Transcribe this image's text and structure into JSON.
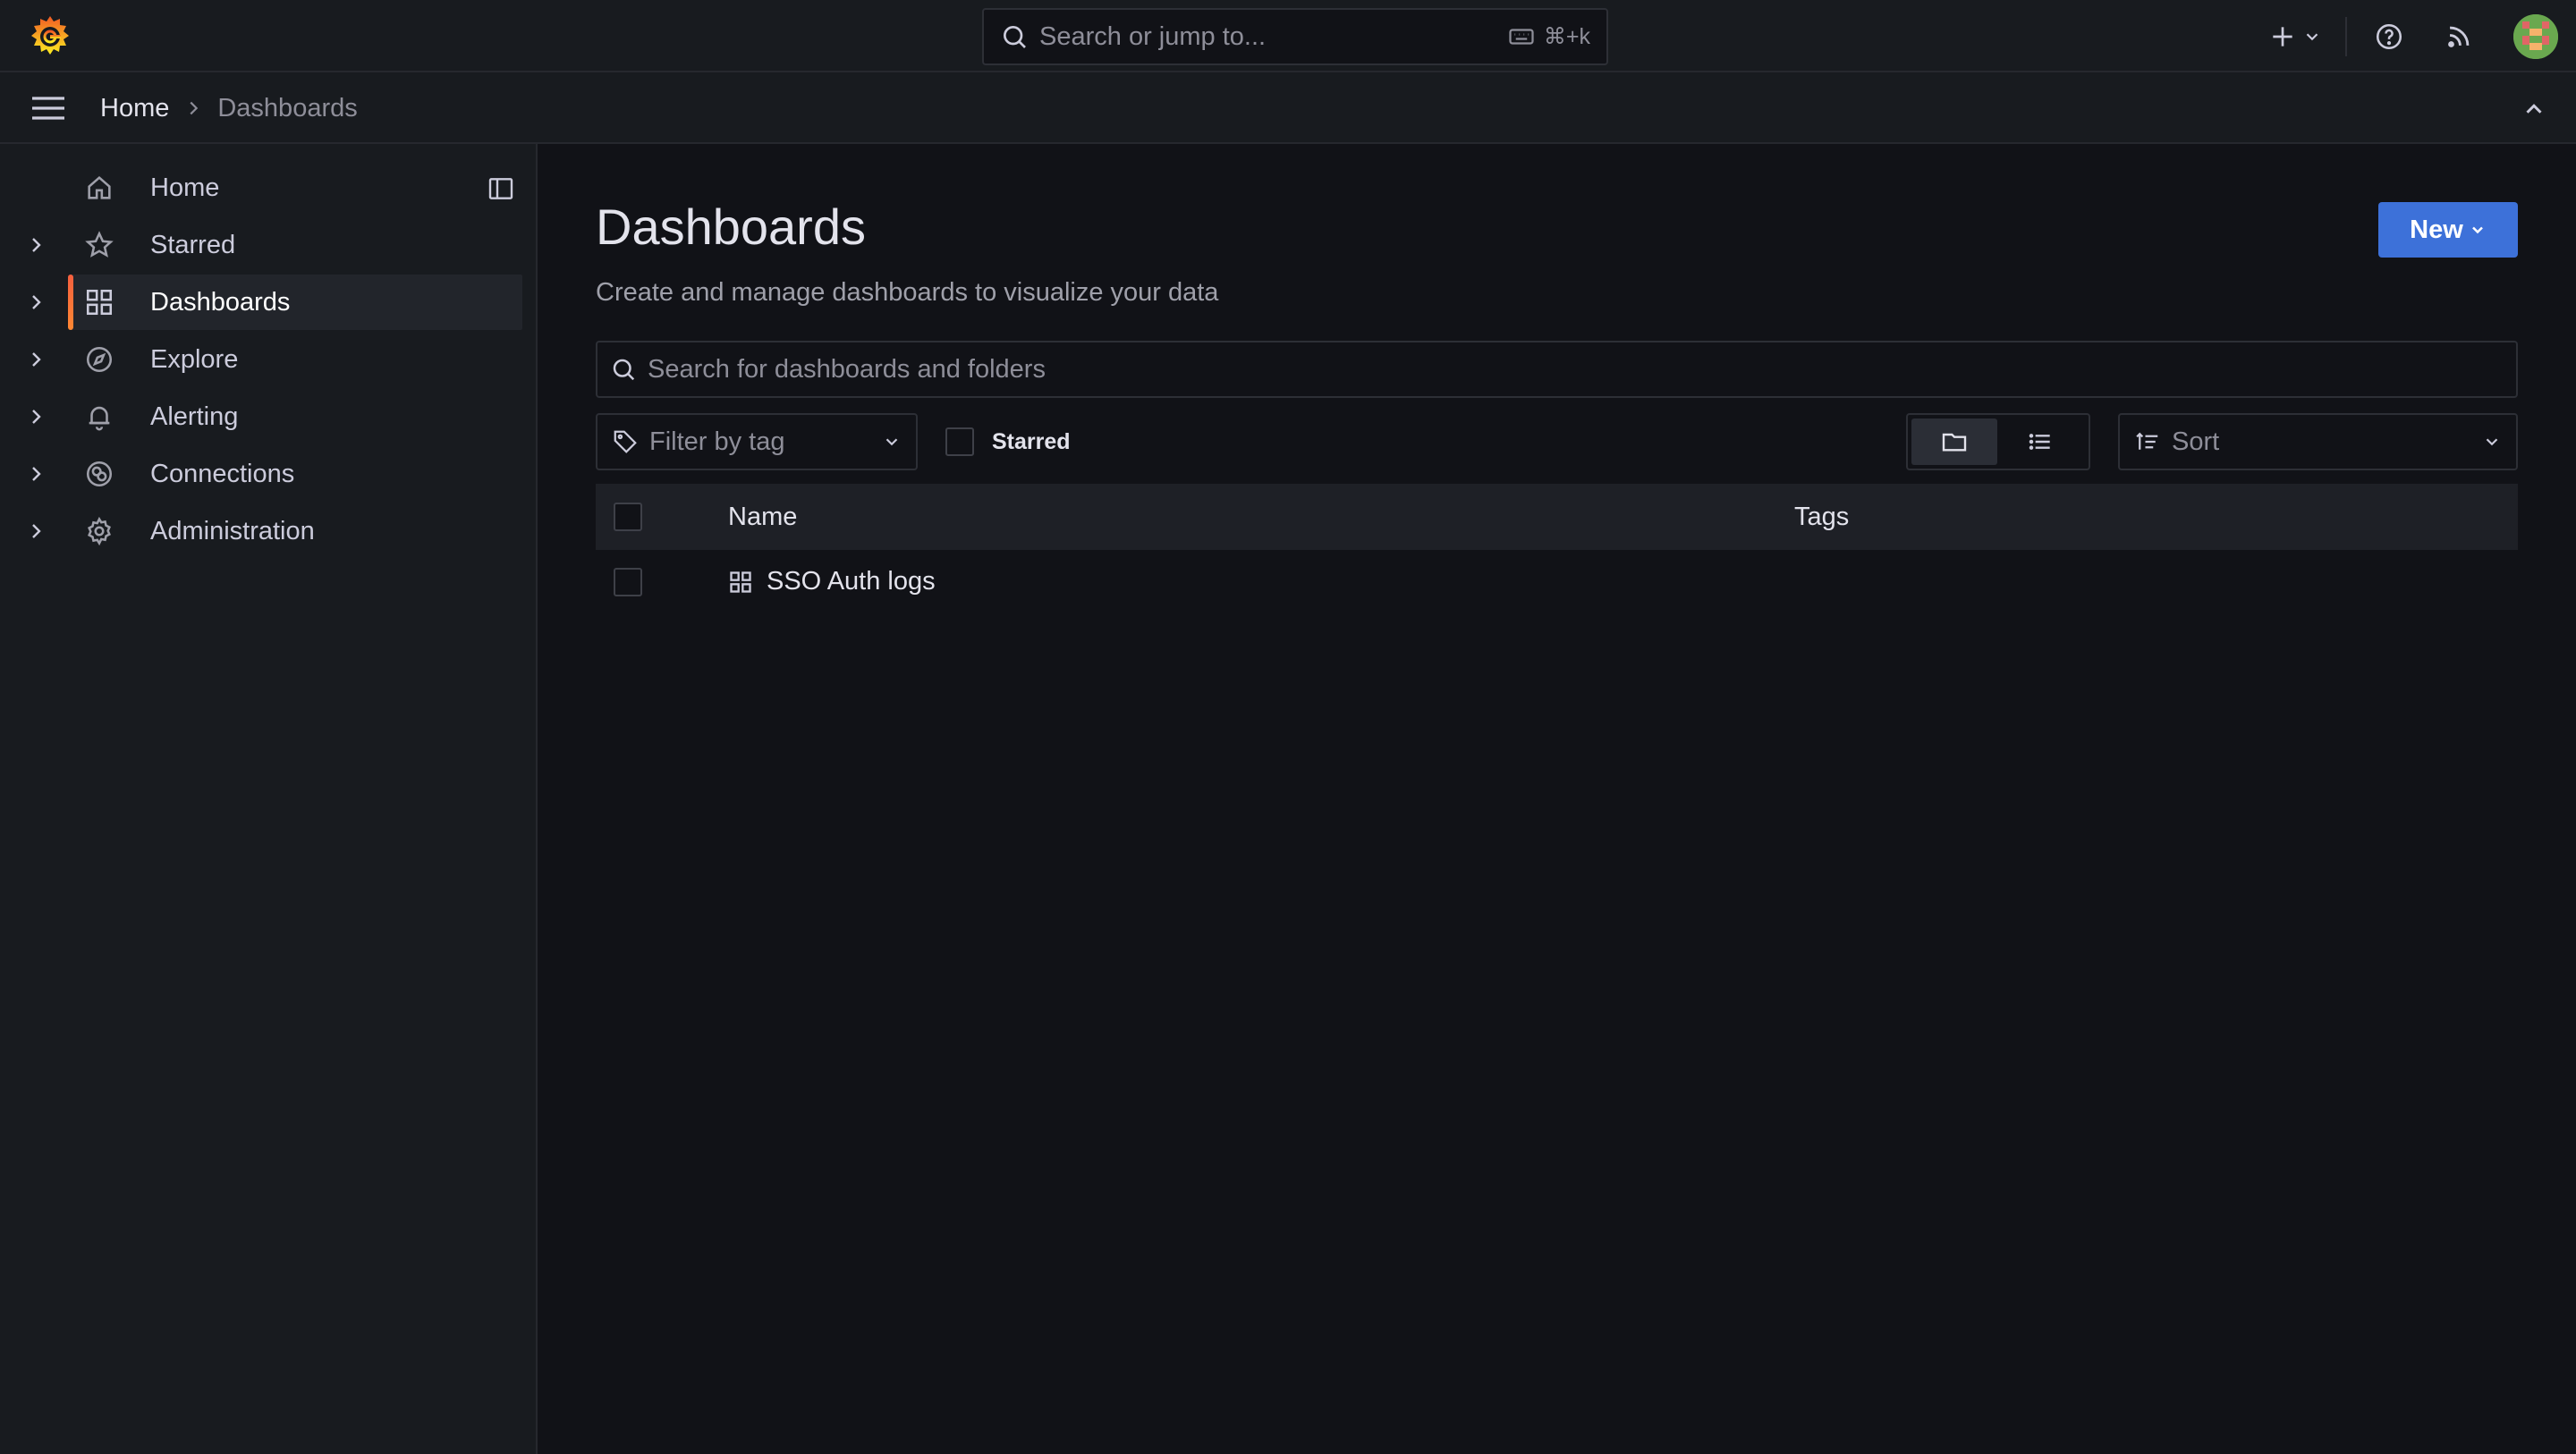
{
  "topbar": {
    "search_placeholder": "Search or jump to...",
    "search_shortcut": "⌘+k"
  },
  "breadcrumb": {
    "items": [
      "Home",
      "Dashboards"
    ]
  },
  "sidebar": {
    "items": [
      {
        "label": "Home",
        "icon": "home-icon",
        "expandable": false
      },
      {
        "label": "Starred",
        "icon": "star-icon",
        "expandable": true
      },
      {
        "label": "Dashboards",
        "icon": "apps-grid-icon",
        "expandable": true,
        "active": true
      },
      {
        "label": "Explore",
        "icon": "compass-icon",
        "expandable": true
      },
      {
        "label": "Alerting",
        "icon": "bell-icon",
        "expandable": true
      },
      {
        "label": "Connections",
        "icon": "connections-icon",
        "expandable": true
      },
      {
        "label": "Administration",
        "icon": "gear-icon",
        "expandable": true
      }
    ]
  },
  "main": {
    "title": "Dashboards",
    "subtitle": "Create and manage dashboards to visualize your data",
    "new_button": "New",
    "search_placeholder": "Search for dashboards and folders",
    "tag_filter_placeholder": "Filter by tag",
    "starred_label": "Starred",
    "sort_placeholder": "Sort",
    "table": {
      "columns": [
        "Name",
        "Tags"
      ],
      "rows": [
        {
          "name": "SSO Auth logs",
          "icon": "apps-grid-icon",
          "tags": []
        }
      ]
    }
  },
  "colors": {
    "background": "#111217",
    "panel": "#181b1f",
    "primary_button": "#3d71d9",
    "active_accent": "#f55f3e",
    "text": "#ccccdc"
  }
}
